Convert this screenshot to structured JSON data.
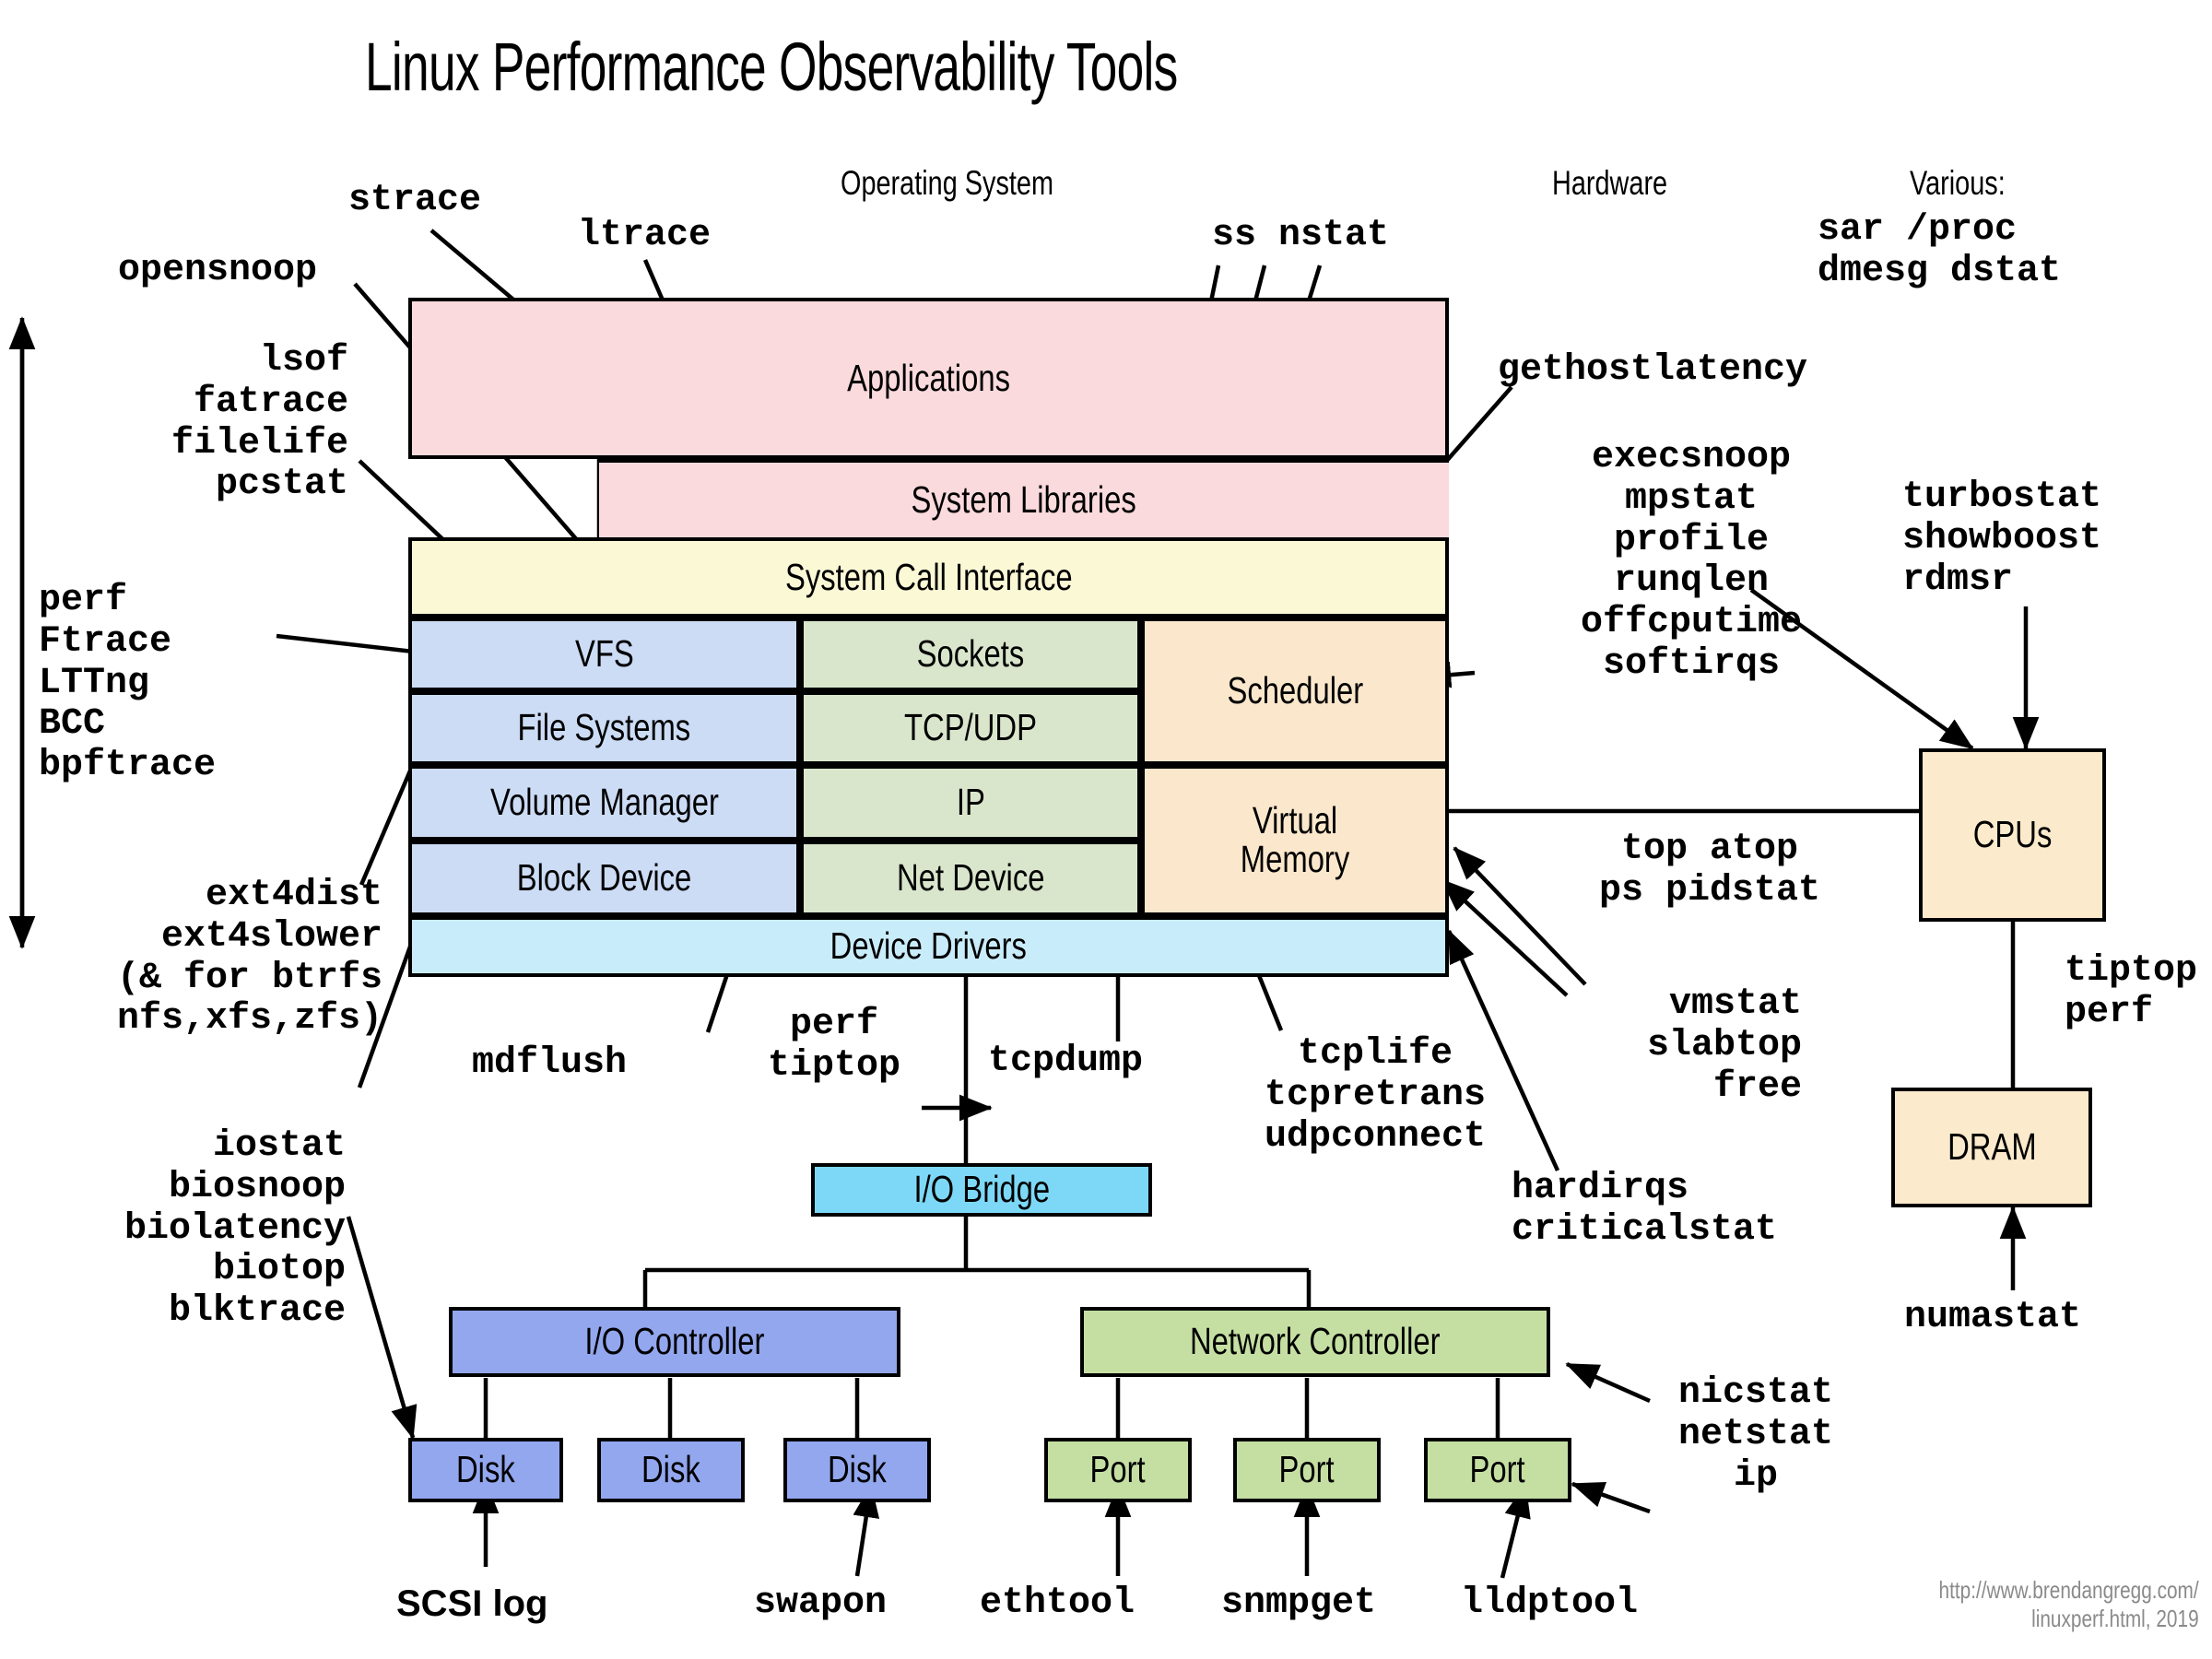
{
  "title": "Linux Performance Observability Tools",
  "headers": {
    "operating_system": "Operating System",
    "hardware": "Hardware",
    "various": "Various:"
  },
  "colors": {
    "applications": "#fadadd",
    "syscall": "#fbf8d6",
    "kernel_fs": "#ccdcf5",
    "kernel_net": "#d9e6cc",
    "kernel_sched": "#fbe8cc",
    "device_drivers": "#c9ecfb",
    "io_bridge": "#7dd8f7",
    "io_controller": "#93a7ef",
    "disk": "#93a7ef",
    "net_controller": "#c5dfa3",
    "port": "#c5dfa3",
    "cpus": "#fbeacb",
    "dram": "#fbeacb",
    "stroke": "#000000",
    "credit": "#8a8a8a"
  },
  "stack": {
    "applications": "Applications",
    "system_libraries": "System Libraries",
    "system_call_interface": "System Call Interface",
    "vfs": "VFS",
    "file_systems": "File Systems",
    "volume_manager": "Volume Manager",
    "block_device": "Block Device",
    "sockets": "Sockets",
    "tcp_udp": "TCP/UDP",
    "ip": "IP",
    "net_device": "Net Device",
    "scheduler": "Scheduler",
    "virtual_memory": "Virtual\nMemory",
    "device_drivers": "Device Drivers"
  },
  "hardware": {
    "io_bridge": "I/O Bridge",
    "io_controller": "I/O Controller",
    "network_controller": "Network Controller",
    "disk1": "Disk",
    "disk2": "Disk",
    "disk3": "Disk",
    "port1": "Port",
    "port2": "Port",
    "port3": "Port",
    "cpus": "CPUs",
    "dram": "DRAM"
  },
  "tools": {
    "strace": "strace",
    "ltrace": "ltrace",
    "opensnoop": "opensnoop",
    "lsof_group": "lsof\nfatrace\nfilelife\npcstat",
    "tracers": "perf\nFtrace\nLTTng\nBCC\nbpftrace",
    "ext4_group": "ext4dist\next4slower\n(& for btrfs\nnfs,xfs,zfs)",
    "io_group": "iostat\nbiosnoop\nbiolatency\nbiotop\nblktrace",
    "ss_nstat": "ss nstat",
    "sar_proc": "sar /proc\ndmesg dstat",
    "gethostlatency": "gethostlatency",
    "sched_group": "execsnoop\nmpstat\nprofile\nrunqlen\noffcputime\nsoftirqs",
    "turbostat_group": "turbostat\nshowboost\nrdmsr",
    "top_group": "top atop\nps pidstat",
    "vmstat_group": "vmstat\nslabtop\nfree",
    "hardirqs_group": "hardirqs\ncriticalstat",
    "tiptop_perf": "tiptop\nperf",
    "numastat": "numastat",
    "mdflush": "mdflush",
    "perf_tiptop": "perf\ntiptop",
    "tcpdump": "tcpdump",
    "tcplife_group": "tcplife\ntcpretrans\nudpconnect",
    "nicstat_group": "nicstat\nnetstat\nip",
    "scsi_log": "SCSI log",
    "swapon": "swapon",
    "ethtool": "ethtool",
    "snmpget": "snmpget",
    "lldptool": "lldptool"
  },
  "credit": "http://www.brendangregg.com/\nlinuxperf.html, 2019"
}
